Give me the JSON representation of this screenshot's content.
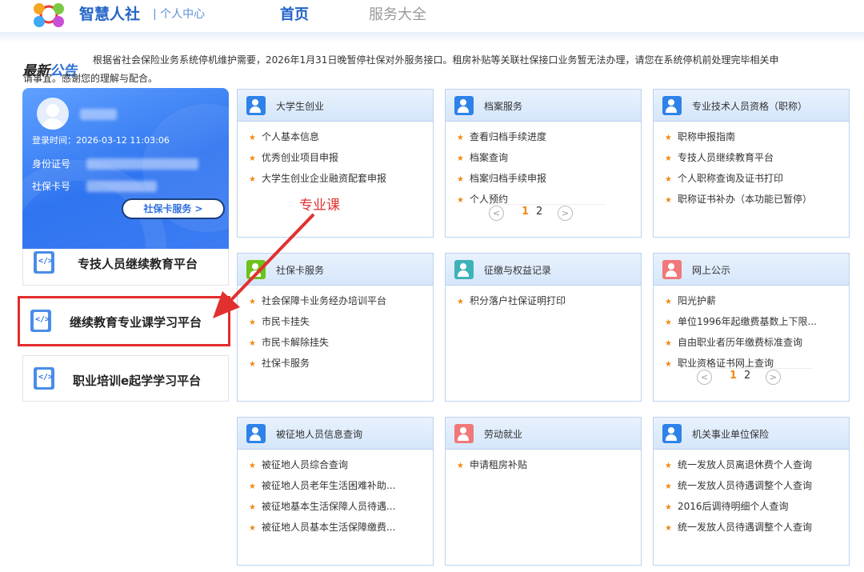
{
  "header": {
    "brand": "智慧人社",
    "brand_sub": "| 个人中心",
    "nav_home": "首页",
    "nav_all": "服务大全"
  },
  "notice": {
    "tag_prefix": "最新",
    "tag_suffix": "公告",
    "text_line1": "根据省社会保险业务系统停机维护需要，2026年1月31日晚暂停社保对外服务接口。租房补贴等关联社保接口业务暂无法办理，请您在系统停机前处理完毕相关申",
    "text_line2": "请事宜。感谢您的理解与配合。"
  },
  "user_card": {
    "login_time": "登录时间：2026-03-12 11:03:06",
    "id_label": "身份证号",
    "card_label": "社保卡号",
    "card_button": "社保卡服务 >"
  },
  "platforms": [
    {
      "label": "专技人员继续教育平台"
    },
    {
      "label": "继续教育专业课学习平台"
    },
    {
      "label": "职业培训e起学学习平台"
    }
  ],
  "annotation": {
    "label": "专业课"
  },
  "services": [
    {
      "title": "大学生创业",
      "items": [
        "个人基本信息",
        "优秀创业项目申报",
        "大学生创业企业融资配套申报"
      ]
    },
    {
      "title": "档案服务",
      "items": [
        "查看归档手续进度",
        "档案查询",
        "档案归档手续申报",
        "个人预约"
      ],
      "pages": [
        "1",
        "2"
      ]
    },
    {
      "title": "专业技术人员资格（职称）",
      "items": [
        "职称申报指南",
        "专技人员继续教育平台",
        "个人职称查询及证书打印",
        "职称证书补办（本功能已暂停）"
      ]
    },
    {
      "title": "社保卡服务",
      "items": [
        "社会保障卡业务经办培训平台",
        "市民卡挂失",
        "市民卡解除挂失",
        "社保卡服务"
      ]
    },
    {
      "title": "征缴与权益记录",
      "items": [
        "积分落户社保证明打印"
      ]
    },
    {
      "title": "网上公示",
      "items": [
        "阳光护薪",
        "单位1996年起缴费基数上下限...",
        "自由职业者历年缴费标准查询",
        "职业资格证书网上查询"
      ],
      "pages": [
        "1",
        "2"
      ]
    },
    {
      "title": "被征地人员信息查询",
      "items": [
        "被征地人员综合查询",
        "被征地人员老年生活困难补助...",
        "被征地基本生活保障人员待遇...",
        "被征地人员基本生活保障缴费..."
      ]
    },
    {
      "title": "劳动就业",
      "items": [
        "申请租房补贴"
      ]
    },
    {
      "title": "机关事业单位保险",
      "items": [
        "统一发放人员离退休费个人查询",
        "统一发放人员待遇调整个人查询",
        "2016后调待明细个人查询",
        "统一发放人员待遇调整个人查询"
      ]
    }
  ],
  "colors": {
    "accent": "#2465c8",
    "highlight": "#e32b2b",
    "star": "#f08a17"
  }
}
